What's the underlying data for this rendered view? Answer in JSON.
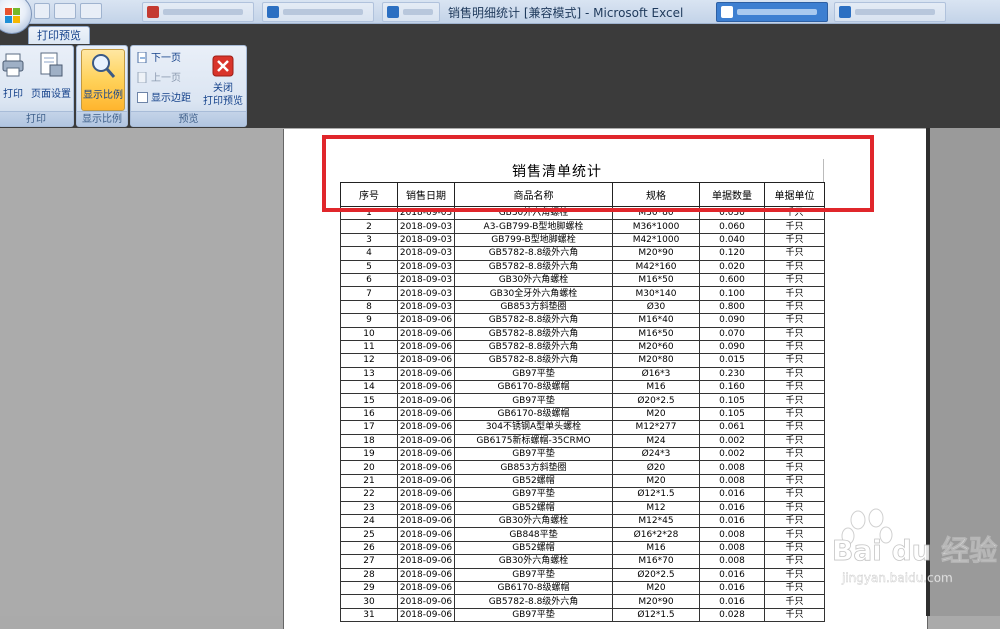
{
  "window": {
    "title": "销售明细统计 [兼容模式] - Microsoft Excel"
  },
  "ribbon": {
    "active_tab": "打印预览",
    "groups": [
      {
        "label": "打印",
        "buttons": [
          "打印",
          "页面设置"
        ]
      },
      {
        "label": "显示比例",
        "buttons": [
          "显示比例"
        ]
      },
      {
        "label": "预览",
        "small_buttons": [
          "下一页",
          "上一页",
          "显示边距"
        ],
        "big_button": "关闭\n打印预览"
      }
    ],
    "close_label_line1": "关闭",
    "close_label_line2": "打印预览",
    "show_margins_checked": false,
    "prev_page_disabled": true
  },
  "sheet": {
    "title": "销售清单统计",
    "headers": [
      "序号",
      "销售日期",
      "商品名称",
      "规格",
      "单据数量",
      "单据单位"
    ],
    "rows": [
      [
        "1",
        "2018-09-03",
        "GB30外六角螺栓",
        "M30*80",
        "0.030",
        "千只"
      ],
      [
        "2",
        "2018-09-03",
        "A3-GB799-B型地脚螺栓",
        "M36*1000",
        "0.060",
        "千只"
      ],
      [
        "3",
        "2018-09-03",
        "GB799-B型地脚螺栓",
        "M42*1000",
        "0.040",
        "千只"
      ],
      [
        "4",
        "2018-09-03",
        "GB5782-8.8级外六角",
        "M20*90",
        "0.120",
        "千只"
      ],
      [
        "5",
        "2018-09-03",
        "GB5782-8.8级外六角",
        "M42*160",
        "0.020",
        "千只"
      ],
      [
        "6",
        "2018-09-03",
        "GB30外六角螺栓",
        "M16*50",
        "0.600",
        "千只"
      ],
      [
        "7",
        "2018-09-03",
        "GB30全牙外六角螺栓",
        "M30*140",
        "0.100",
        "千只"
      ],
      [
        "8",
        "2018-09-03",
        "GB853方斜垫圈",
        "Ø30",
        "0.800",
        "千只"
      ],
      [
        "9",
        "2018-09-06",
        "GB5782-8.8级外六角",
        "M16*40",
        "0.090",
        "千只"
      ],
      [
        "10",
        "2018-09-06",
        "GB5782-8.8级外六角",
        "M16*50",
        "0.070",
        "千只"
      ],
      [
        "11",
        "2018-09-06",
        "GB5782-8.8级外六角",
        "M20*60",
        "0.090",
        "千只"
      ],
      [
        "12",
        "2018-09-06",
        "GB5782-8.8级外六角",
        "M20*80",
        "0.015",
        "千只"
      ],
      [
        "13",
        "2018-09-06",
        "GB97平垫",
        "Ø16*3",
        "0.230",
        "千只"
      ],
      [
        "14",
        "2018-09-06",
        "GB6170-8级螺帽",
        "M16",
        "0.160",
        "千只"
      ],
      [
        "15",
        "2018-09-06",
        "GB97平垫",
        "Ø20*2.5",
        "0.105",
        "千只"
      ],
      [
        "16",
        "2018-09-06",
        "GB6170-8级螺帽",
        "M20",
        "0.105",
        "千只"
      ],
      [
        "17",
        "2018-09-06",
        "304不锈钢A型单头螺栓",
        "M12*277",
        "0.061",
        "千只"
      ],
      [
        "18",
        "2018-09-06",
        "GB6175新标螺帽-35CRMO",
        "M24",
        "0.002",
        "千只"
      ],
      [
        "19",
        "2018-09-06",
        "GB97平垫",
        "Ø24*3",
        "0.002",
        "千只"
      ],
      [
        "20",
        "2018-09-06",
        "GB853方斜垫圈",
        "Ø20",
        "0.008",
        "千只"
      ],
      [
        "21",
        "2018-09-06",
        "GB52螺帽",
        "M20",
        "0.008",
        "千只"
      ],
      [
        "22",
        "2018-09-06",
        "GB97平垫",
        "Ø12*1.5",
        "0.016",
        "千只"
      ],
      [
        "23",
        "2018-09-06",
        "GB52螺帽",
        "M12",
        "0.016",
        "千只"
      ],
      [
        "24",
        "2018-09-06",
        "GB30外六角螺栓",
        "M12*45",
        "0.016",
        "千只"
      ],
      [
        "25",
        "2018-09-06",
        "GB848平垫",
        "Ø16*2*28",
        "0.008",
        "千只"
      ],
      [
        "26",
        "2018-09-06",
        "GB52螺帽",
        "M16",
        "0.008",
        "千只"
      ],
      [
        "27",
        "2018-09-06",
        "GB30外六角螺栓",
        "M16*70",
        "0.008",
        "千只"
      ],
      [
        "28",
        "2018-09-06",
        "GB97平垫",
        "Ø20*2.5",
        "0.016",
        "千只"
      ],
      [
        "29",
        "2018-09-06",
        "GB6170-8级螺帽",
        "M20",
        "0.016",
        "千只"
      ],
      [
        "30",
        "2018-09-06",
        "GB5782-8.8级外六角",
        "M20*90",
        "0.016",
        "千只"
      ],
      [
        "31",
        "2018-09-06",
        "GB97平垫",
        "Ø12*1.5",
        "0.028",
        "千只"
      ]
    ]
  },
  "watermark": {
    "brand": "Bai du 经验",
    "url": "jingyan.baidu.com"
  },
  "colors": {
    "highlight": "#e0262b",
    "active_button": "#ffd25a"
  }
}
